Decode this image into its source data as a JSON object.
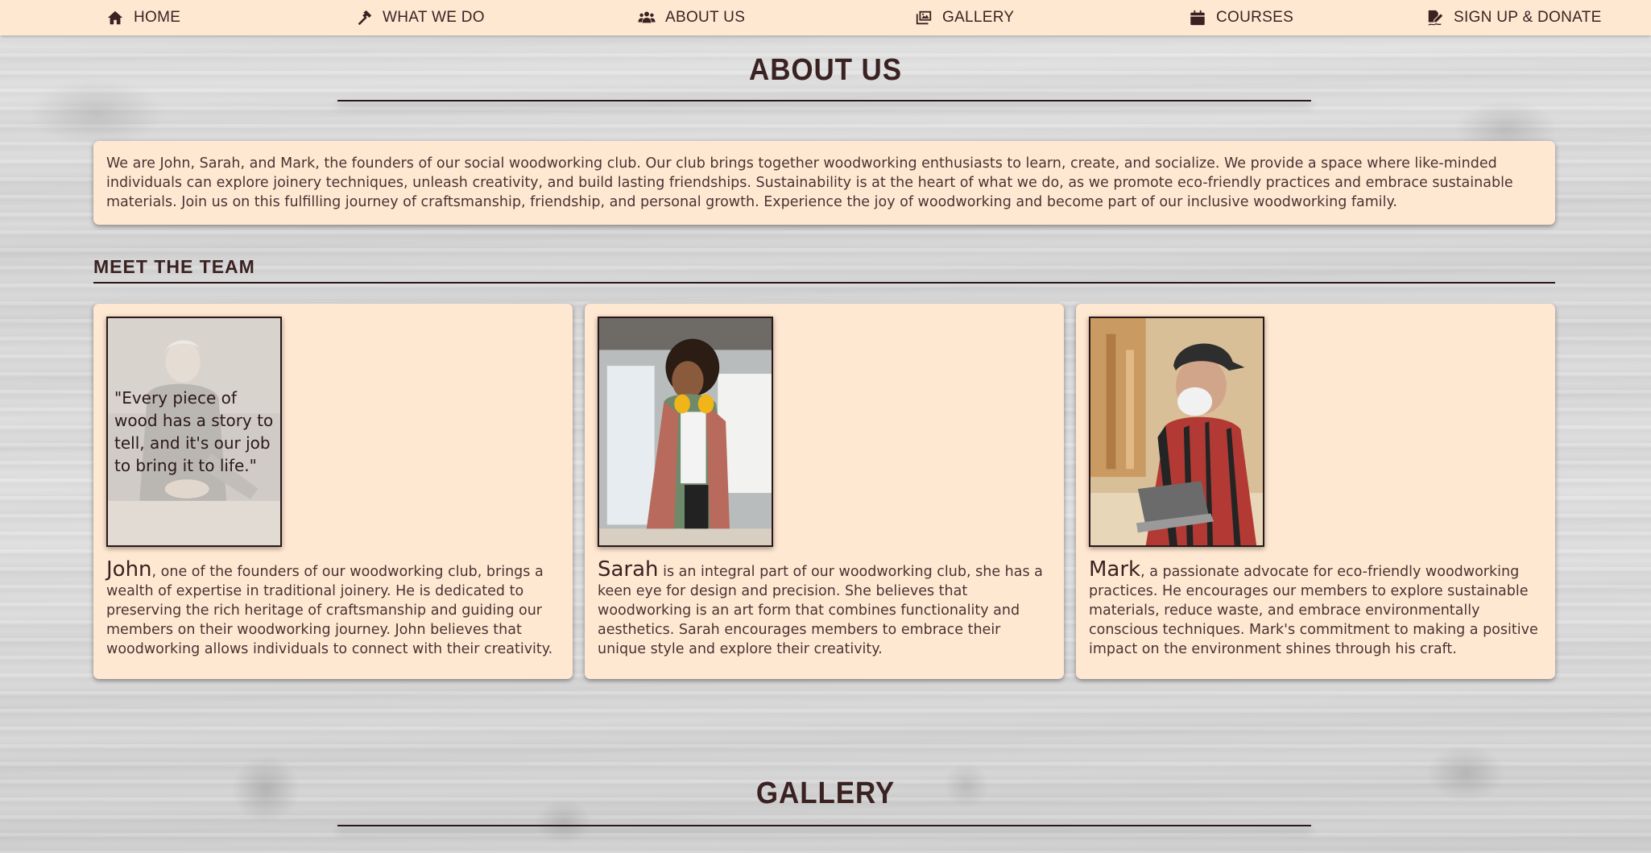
{
  "nav": {
    "items": [
      {
        "label": "HOME",
        "icon": "home-icon"
      },
      {
        "label": "WHAT WE DO",
        "icon": "hammer-icon"
      },
      {
        "label": "ABOUT US",
        "icon": "users-icon"
      },
      {
        "label": "GALLERY",
        "icon": "images-icon"
      },
      {
        "label": "COURSES",
        "icon": "calendar-icon"
      },
      {
        "label": "SIGN UP & DONATE",
        "icon": "signature-icon"
      }
    ]
  },
  "about": {
    "title": "ABOUT US",
    "intro": "We are John, Sarah, and Mark, the founders of our social woodworking club. Our club brings together woodworking enthusiasts to learn, create, and socialize. We provide a space where like-minded individuals can explore joinery techniques, unleash creativity, and build lasting friendships. Sustainability is at the heart of what we do, as we promote eco-friendly practices and embrace sustainable materials. Join us on this fulfilling journey of craftsmanship, friendship, and personal growth. Experience the joy of woodworking and become part of our inclusive woodworking family."
  },
  "team": {
    "heading": "MEET THE TEAM",
    "members": [
      {
        "name": "John",
        "bio": ", one of the founders of our woodworking club, brings a wealth of expertise in traditional joinery. He is dedicated to preserving the rich heritage of craftsmanship and guiding our members on their woodworking journey. John believes that woodworking allows individuals to connect with their creativity.",
        "quote": "\"Every piece of wood has a story to tell, and it's our job to bring it to life.\""
      },
      {
        "name": "Sarah",
        "bio": " is an integral part of our woodworking club, she has a keen eye for design and precision. She believes that woodworking is an art form that combines functionality and aesthetics. Sarah encourages members to embrace their unique style and explore their creativity."
      },
      {
        "name": "Mark",
        "bio": ", a passionate advocate for eco-friendly woodworking practices. He encourages our members to explore sustainable materials, reduce waste, and embrace environmentally conscious techniques. Mark's commitment to making a positive impact on the environment shines through his craft."
      }
    ]
  },
  "gallery": {
    "title": "GALLERY"
  },
  "colors": {
    "nav_bg": "#ffe8d2",
    "card_bg": "#ffe8d2",
    "text": "#3b2222"
  }
}
